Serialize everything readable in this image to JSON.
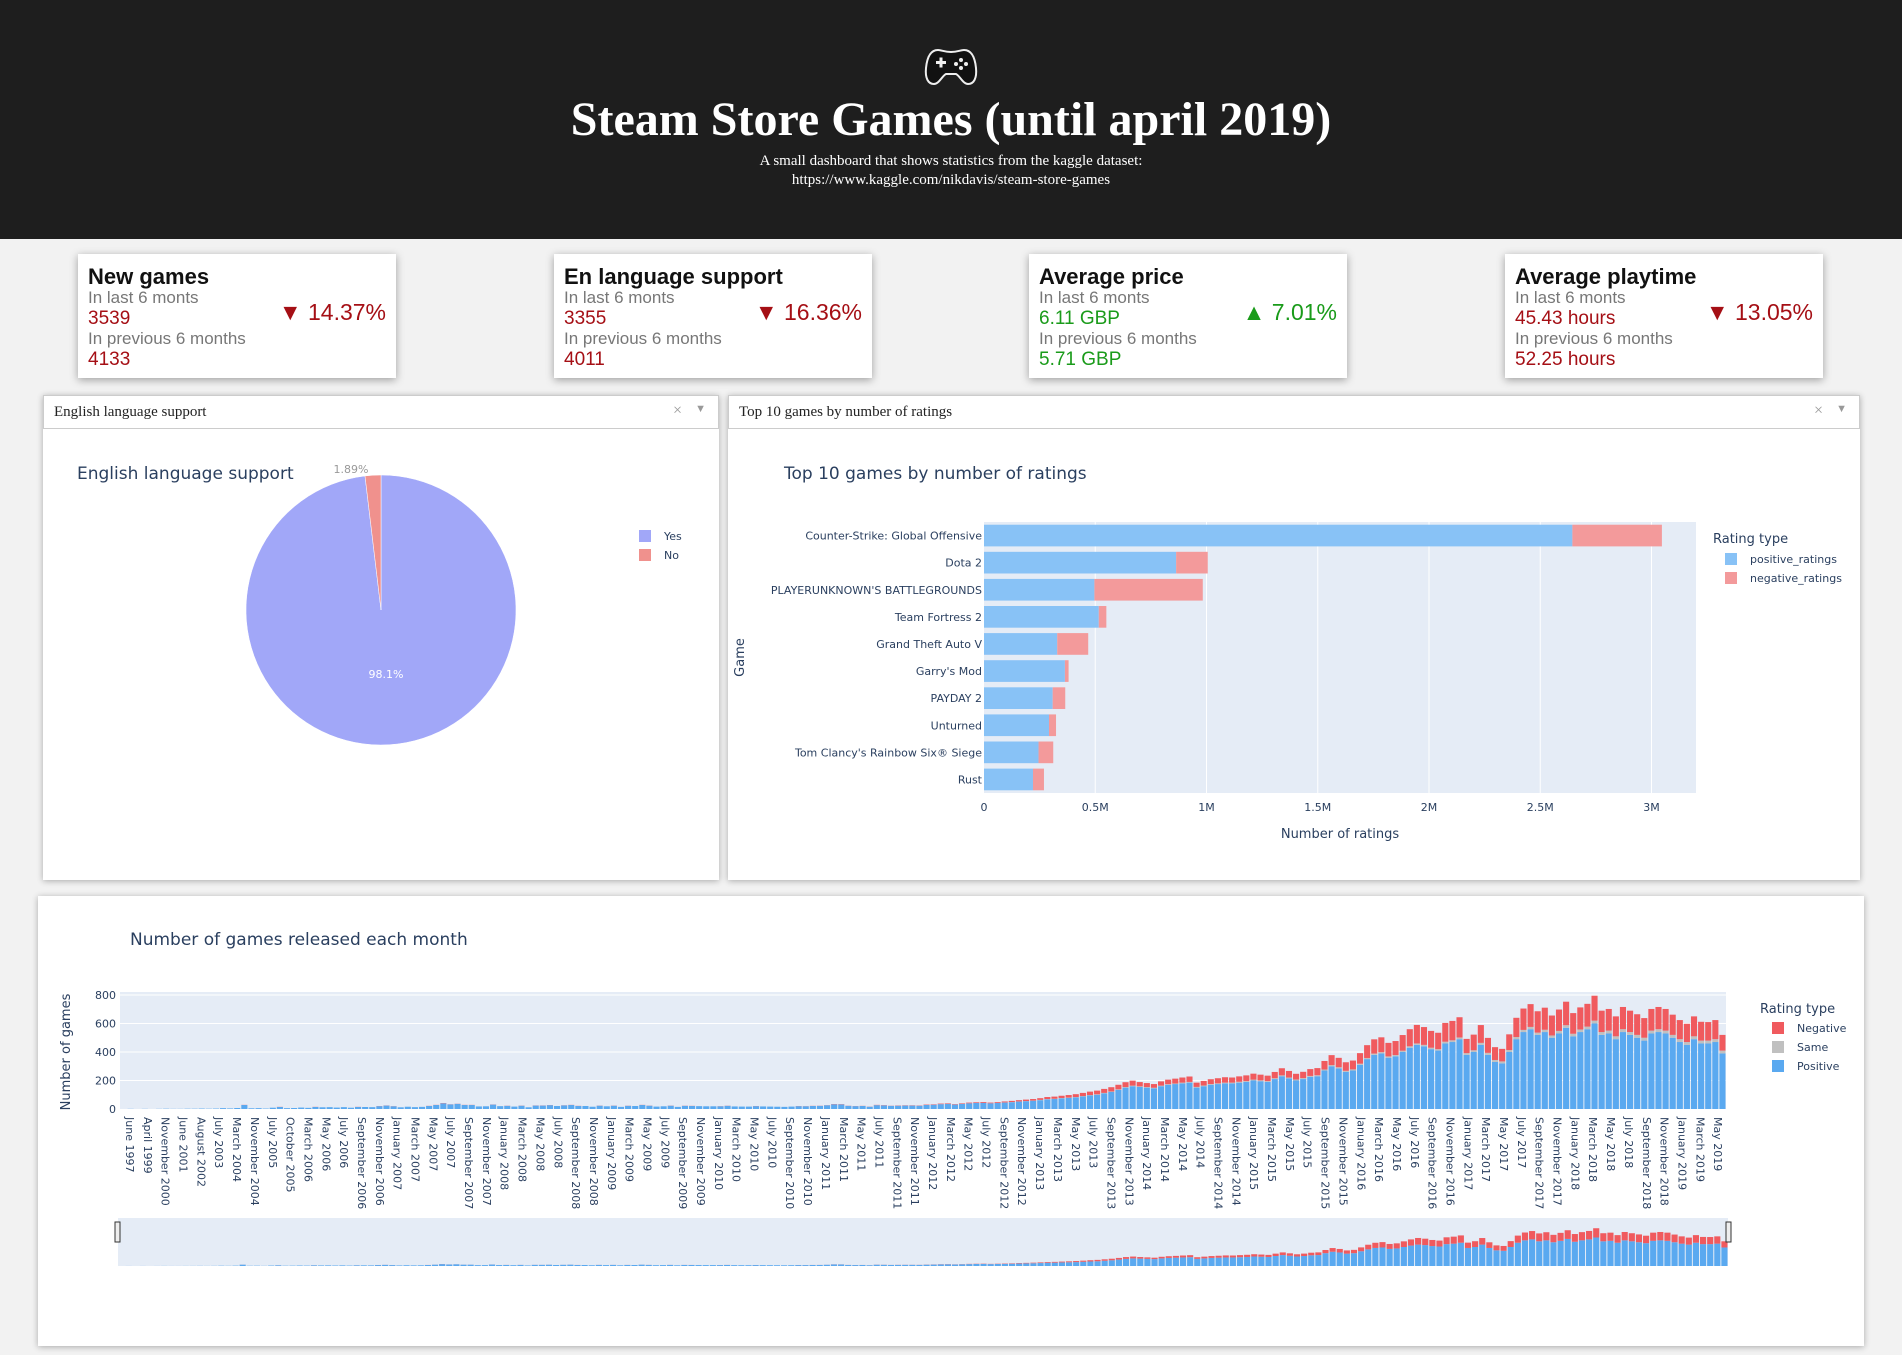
{
  "header": {
    "title": "Steam Store Games (until april 2019)",
    "subtitle_line1": "A small dashboard that shows statistics from the kaggle dataset:",
    "subtitle_line2": "https://www.kaggle.com/nikdavis/steam-store-games",
    "icon": "gamepad-icon"
  },
  "colors": {
    "header_bg": "#1e1e1e",
    "down": "#a50f15",
    "up": "#1a9b1a",
    "yes": "#a1a7f8",
    "no": "#f0918d",
    "positive": "#88c2f6",
    "negative": "#f39a9b",
    "monthly_positive": "#5aa9f0",
    "monthly_negative": "#f05a5e",
    "monthly_same": "#c0c0c0"
  },
  "kpis": [
    {
      "title": "New games",
      "last_label": "In last 6 monts",
      "last_value": "3539",
      "change": "▼ 14.37%",
      "direction": "down",
      "prev_label": "In previous 6 months",
      "prev_value": "4133"
    },
    {
      "title": "En language support",
      "last_label": "In last 6 monts",
      "last_value": "3355",
      "change": "▼ 16.36%",
      "direction": "down",
      "prev_label": "In previous 6 months",
      "prev_value": "4011"
    },
    {
      "title": "Average price",
      "last_label": "In last 6 monts",
      "last_value": "6.11 GBP",
      "change": "▲ 7.01%",
      "direction": "up",
      "prev_label": "In previous 6 months",
      "prev_value": "5.71 GBP"
    },
    {
      "title": "Average playtime",
      "last_label": "In last 6 monts",
      "last_value": "45.43 hours",
      "change": "▼ 13.05%",
      "direction": "down",
      "prev_label": "In previous 6 months",
      "prev_value": "52.25 hours"
    }
  ],
  "pie_panel": {
    "dropdown_value": "English language support",
    "dropdown_clear": "×",
    "dropdown_arrow": "▼"
  },
  "bar_panel": {
    "dropdown_value": "Top 10 games by number of ratings",
    "dropdown_clear": "×",
    "dropdown_arrow": "▼"
  },
  "chart_data": [
    {
      "type": "pie",
      "title": "English language support",
      "labels": [
        "Yes",
        "No"
      ],
      "values": [
        98.1,
        1.89
      ],
      "value_labels": [
        "98.1%",
        "1.89%"
      ],
      "legend": "top-right"
    },
    {
      "type": "bar",
      "orientation": "horizontal",
      "stacked": true,
      "title": "Top 10 games by number of ratings",
      "xlabel": "Number of ratings",
      "ylabel": "Game",
      "xlim": [
        0,
        3200000
      ],
      "x_ticks": [
        0,
        500000,
        1000000,
        1500000,
        2000000,
        2500000,
        3000000
      ],
      "x_tick_labels": [
        "0",
        "0.5M",
        "1M",
        "1.5M",
        "2M",
        "2.5M",
        "3M"
      ],
      "legend_title": "Rating type",
      "legend": "top-right",
      "categories": [
        "Counter-Strike: Global Offensive",
        "Dota 2",
        "PLAYERUNKNOWN'S BATTLEGROUNDS",
        "Team Fortress 2",
        "Grand Theft Auto V",
        "Garry's Mod",
        "PAYDAY 2",
        "Unturned",
        "Tom Clancy's Rainbow Six® Siege",
        "Rust"
      ],
      "series": [
        {
          "name": "positive_ratings",
          "values": [
            2644404,
            863507,
            496184,
            515879,
            329061,
            363721,
            308657,
            292180,
            245115,
            220161
          ]
        },
        {
          "name": "negative_ratings",
          "values": [
            402313,
            142079,
            487076,
            34036,
            139308,
            16433,
            56523,
            31482,
            66087,
            49329
          ]
        }
      ]
    },
    {
      "type": "bar",
      "stacked": true,
      "title": "Number of games released each month",
      "ylabel": "Number of games",
      "xlabel": "",
      "ylim": [
        0,
        800
      ],
      "y_ticks": [
        0,
        200,
        400,
        600,
        800
      ],
      "legend_title": "Rating type",
      "legend": "top-right",
      "legend_entries": [
        "Negative",
        "Same",
        "Positive"
      ],
      "x_tick_labels": [
        "June 1997",
        "April 1999",
        "November 2000",
        "June 2001",
        "August 2002",
        "July 2003",
        "March 2004",
        "November 2004",
        "July 2005",
        "October 2005",
        "March 2006",
        "May 2006",
        "July 2006",
        "September 2006",
        "November 2006",
        "January 2007",
        "March 2007",
        "May 2007",
        "July 2007",
        "September 2007",
        "November 2007",
        "January 2008",
        "March 2008",
        "May 2008",
        "July 2008",
        "September 2008",
        "November 2008",
        "January 2009",
        "March 2009",
        "May 2009",
        "July 2009",
        "September 2009",
        "November 2009",
        "January 2010",
        "March 2010",
        "May 2010",
        "July 2010",
        "September 2010",
        "November 2010",
        "January 2011",
        "March 2011",
        "May 2011",
        "July 2011",
        "September 2011",
        "November 2011",
        "January 2012",
        "March 2012",
        "May 2012",
        "July 2012",
        "September 2012",
        "November 2012",
        "January 2013",
        "March 2013",
        "May 2013",
        "July 2013",
        "September 2013",
        "November 2013",
        "January 2014",
        "March 2014",
        "May 2014",
        "July 2014",
        "September 2014",
        "November 2014",
        "January 2015",
        "March 2015",
        "May 2015",
        "July 2015",
        "September 2015",
        "November 2015",
        "January 2016",
        "March 2016",
        "May 2016",
        "July 2016",
        "September 2016",
        "November 2016",
        "January 2017",
        "March 2017",
        "May 2017",
        "July 2017",
        "September 2017",
        "November 2017",
        "January 2018",
        "March 2018",
        "May 2018",
        "July 2018",
        "September 2018",
        "November 2018",
        "January 2019",
        "March 2019",
        "May 2019"
      ],
      "positive": [
        0,
        1,
        0,
        1,
        0,
        1,
        2,
        1,
        1,
        2,
        2,
        3,
        2,
        3,
        6,
        4,
        7,
        28,
        5,
        6,
        3,
        9,
        14,
        6,
        7,
        10,
        8,
        14,
        12,
        13,
        10,
        13,
        9,
        14,
        14,
        13,
        20,
        24,
        19,
        12,
        16,
        13,
        15,
        21,
        28,
        40,
        32,
        36,
        28,
        28,
        18,
        19,
        31,
        20,
        22,
        17,
        23,
        12,
        24,
        24,
        27,
        21,
        25,
        28,
        21,
        21,
        16,
        23,
        19,
        23,
        15,
        22,
        21,
        28,
        23,
        17,
        19,
        23,
        15,
        22,
        21,
        20,
        19,
        19,
        19,
        22,
        18,
        17,
        17,
        20,
        18,
        17,
        16,
        15,
        17,
        20,
        19,
        21,
        22,
        26,
        33,
        32,
        22,
        20,
        21,
        16,
        27,
        25,
        22,
        23,
        24,
        24,
        23,
        28,
        30,
        34,
        36,
        31,
        36,
        40,
        42,
        43,
        40,
        42,
        45,
        48,
        52,
        55,
        58,
        62,
        68,
        70,
        75,
        78,
        82,
        88,
        95,
        100,
        110,
        120,
        135,
        150,
        160,
        155,
        150,
        145,
        160,
        170,
        175,
        180,
        185,
        150,
        160,
        170,
        175,
        180,
        180,
        185,
        190,
        200,
        195,
        190,
        210,
        230,
        215,
        200,
        210,
        225,
        230,
        270,
        300,
        285,
        260,
        270,
        310,
        350,
        380,
        390,
        360,
        370,
        400,
        430,
        450,
        440,
        420,
        410,
        460,
        470,
        490,
        380,
        400,
        450,
        380,
        330,
        320,
        400,
        490,
        540,
        560,
        520,
        540,
        500,
        530,
        570,
        510,
        540,
        560,
        600,
        520,
        530,
        490,
        540,
        520,
        500,
        480,
        530,
        540,
        530,
        500,
        470,
        450,
        490,
        460,
        460,
        470,
        390
      ],
      "same": [
        0,
        0,
        0,
        0,
        0,
        0,
        0,
        0,
        0,
        0,
        0,
        0,
        0,
        0,
        0,
        0,
        0,
        0,
        0,
        0,
        0,
        0,
        0,
        0,
        0,
        0,
        0,
        0,
        0,
        0,
        0,
        0,
        0,
        0,
        0,
        0,
        0,
        0,
        0,
        0,
        0,
        0,
        0,
        0,
        0,
        0,
        0,
        0,
        0,
        0,
        0,
        0,
        0,
        0,
        0,
        0,
        0,
        0,
        0,
        0,
        0,
        0,
        0,
        0,
        0,
        0,
        0,
        0,
        0,
        0,
        0,
        0,
        0,
        0,
        0,
        0,
        0,
        0,
        0,
        0,
        0,
        0,
        0,
        0,
        0,
        0,
        0,
        0,
        0,
        0,
        0,
        0,
        0,
        0,
        0,
        0,
        0,
        0,
        0,
        0,
        0,
        0,
        0,
        0,
        0,
        0,
        0,
        0,
        0,
        0,
        0,
        0,
        0,
        0,
        0,
        0,
        0,
        0,
        0,
        0,
        0,
        0,
        0,
        0,
        1,
        1,
        1,
        1,
        1,
        2,
        2,
        2,
        2,
        2,
        2,
        3,
        3,
        3,
        3,
        3,
        3,
        4,
        4,
        4,
        4,
        4,
        4,
        4,
        4,
        5,
        5,
        5,
        5,
        5,
        5,
        5,
        5,
        6,
        6,
        6,
        6,
        6,
        6,
        6,
        6,
        7,
        7,
        7,
        7,
        7,
        8,
        8,
        8,
        8,
        8,
        8,
        9,
        9,
        9,
        9,
        9,
        10,
        10,
        10,
        10,
        10,
        12,
        12,
        12,
        12,
        12,
        14,
        14,
        14,
        14,
        14,
        15,
        15,
        16,
        16,
        16,
        16,
        18,
        18,
        18,
        18,
        18,
        20,
        20,
        20,
        20,
        20,
        20,
        20,
        20,
        20,
        20,
        20,
        20,
        20,
        20,
        20,
        20,
        20,
        20,
        20,
        20,
        20,
        20,
        20,
        20,
        20,
        20,
        20,
        20,
        20,
        20,
        20,
        20,
        20
      ],
      "negative": [
        0,
        0,
        0,
        0,
        0,
        0,
        0,
        0,
        0,
        0,
        0,
        0,
        0,
        0,
        0,
        0,
        0,
        1,
        0,
        0,
        0,
        0,
        1,
        0,
        0,
        0,
        0,
        1,
        0,
        0,
        0,
        0,
        0,
        1,
        0,
        0,
        1,
        1,
        1,
        0,
        0,
        0,
        0,
        1,
        1,
        2,
        1,
        1,
        1,
        1,
        0,
        0,
        1,
        0,
        1,
        0,
        1,
        0,
        1,
        1,
        1,
        0,
        1,
        1,
        1,
        0,
        0,
        1,
        0,
        1,
        0,
        1,
        0,
        1,
        1,
        0,
        0,
        1,
        0,
        1,
        1,
        0,
        0,
        0,
        1,
        1,
        0,
        0,
        0,
        1,
        0,
        0,
        0,
        0,
        0,
        1,
        1,
        1,
        1,
        1,
        2,
        2,
        1,
        1,
        1,
        1,
        2,
        2,
        1,
        2,
        2,
        2,
        2,
        3,
        3,
        4,
        4,
        3,
        4,
        5,
        5,
        6,
        5,
        6,
        7,
        8,
        9,
        10,
        11,
        12,
        14,
        15,
        16,
        18,
        20,
        22,
        24,
        26,
        28,
        30,
        32,
        34,
        35,
        30,
        28,
        26,
        30,
        32,
        34,
        36,
        38,
        30,
        32,
        34,
        36,
        38,
        36,
        38,
        40,
        42,
        40,
        38,
        44,
        50,
        46,
        40,
        44,
        48,
        50,
        60,
        70,
        66,
        60,
        62,
        74,
        90,
        100,
        104,
        95,
        98,
        110,
        120,
        130,
        125,
        118,
        115,
        132,
        136,
        142,
        100,
        110,
        125,
        105,
        90,
        88,
        110,
        135,
        150,
        160,
        150,
        155,
        140,
        150,
        165,
        145,
        155,
        160,
        175,
        150,
        152,
        140,
        156,
        150,
        145,
        138,
        152,
        156,
        152,
        142,
        134,
        128,
        140,
        132,
        130,
        134,
        110
      ]
    }
  ]
}
